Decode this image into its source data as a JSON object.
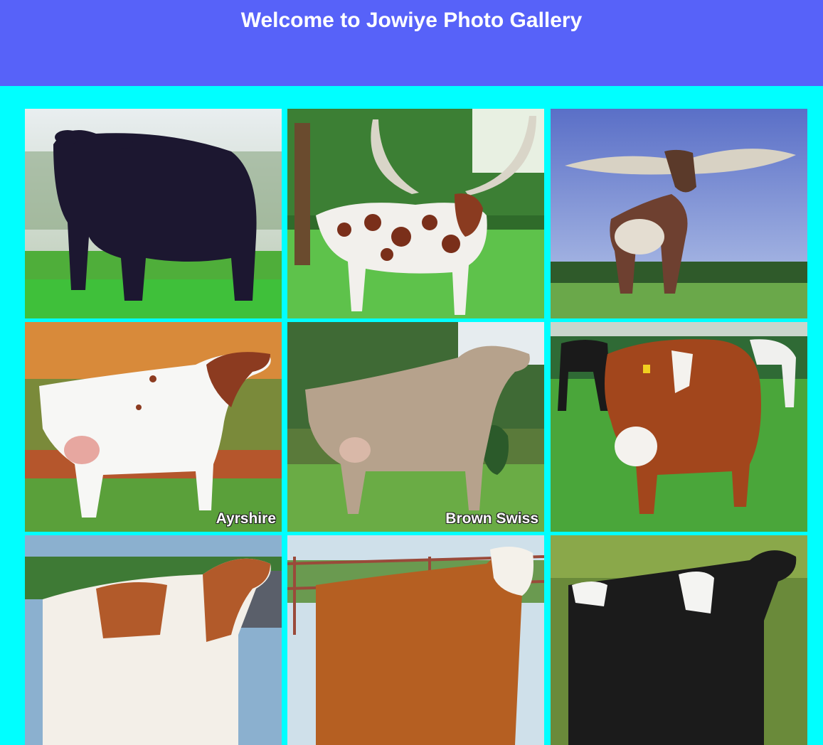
{
  "header": {
    "title": "Welcome to Jowiye Photo Gallery"
  },
  "colors": {
    "header_bg": "#5762f9",
    "page_bg": "#00ffff"
  },
  "gallery": {
    "photos": [
      {
        "subject": "black bull",
        "caption": ""
      },
      {
        "subject": "ankole longhorn spotted",
        "caption": ""
      },
      {
        "subject": "ankole longhorn giant horns",
        "caption": ""
      },
      {
        "subject": "red and white dairy cow",
        "caption": "Ayrshire"
      },
      {
        "subject": "brown dairy cow",
        "caption": "Brown Swiss"
      },
      {
        "subject": "red and white cow in pasture",
        "caption": ""
      },
      {
        "subject": "red and white cow near barn",
        "caption": ""
      },
      {
        "subject": "brown and white hereford",
        "caption": ""
      },
      {
        "subject": "black and white holstein",
        "caption": ""
      }
    ]
  }
}
